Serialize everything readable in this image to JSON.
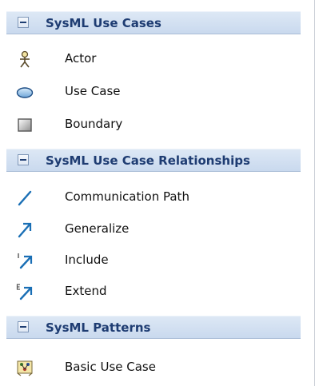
{
  "colors": {
    "header_gradient_top": "#dde8f5",
    "header_gradient_bottom": "#c9d9ee",
    "header_text": "#1e3c72",
    "item_text": "#111111",
    "icon_blue": "#1a6fb5"
  },
  "sections": [
    {
      "title": "SysML Use Cases",
      "collapse_icon": "minus-box-icon",
      "items": [
        {
          "label": "Actor",
          "icon": "actor-icon"
        },
        {
          "label": "Use Case",
          "icon": "ellipse-icon"
        },
        {
          "label": "Boundary",
          "icon": "boundary-icon"
        }
      ]
    },
    {
      "title": "SysML Use Case Relationships",
      "collapse_icon": "minus-box-icon",
      "items": [
        {
          "label": "Communication Path",
          "icon": "line-icon"
        },
        {
          "label": "Generalize",
          "icon": "generalize-arrow-icon"
        },
        {
          "label": "Include",
          "icon": "include-arrow-icon"
        },
        {
          "label": "Extend",
          "icon": "extend-arrow-icon"
        }
      ]
    },
    {
      "title": "SysML Patterns",
      "collapse_icon": "minus-box-icon",
      "items": [
        {
          "label": "Basic Use Case",
          "icon": "pattern-icon"
        }
      ]
    }
  ]
}
